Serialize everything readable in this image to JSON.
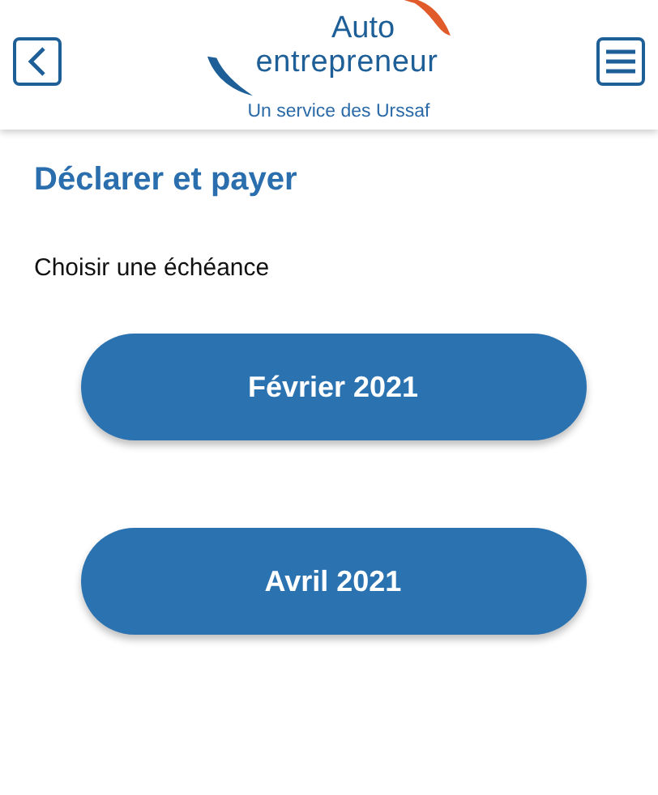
{
  "header": {
    "logo": {
      "line_1": "Auto",
      "line_2": "entrepreneur",
      "tagline": "Un service des Urssaf"
    }
  },
  "title": "Déclarer et payer",
  "prompt": "Choisir une échéance",
  "deadlines": [
    "Février 2021",
    "Avril 2021"
  ]
}
